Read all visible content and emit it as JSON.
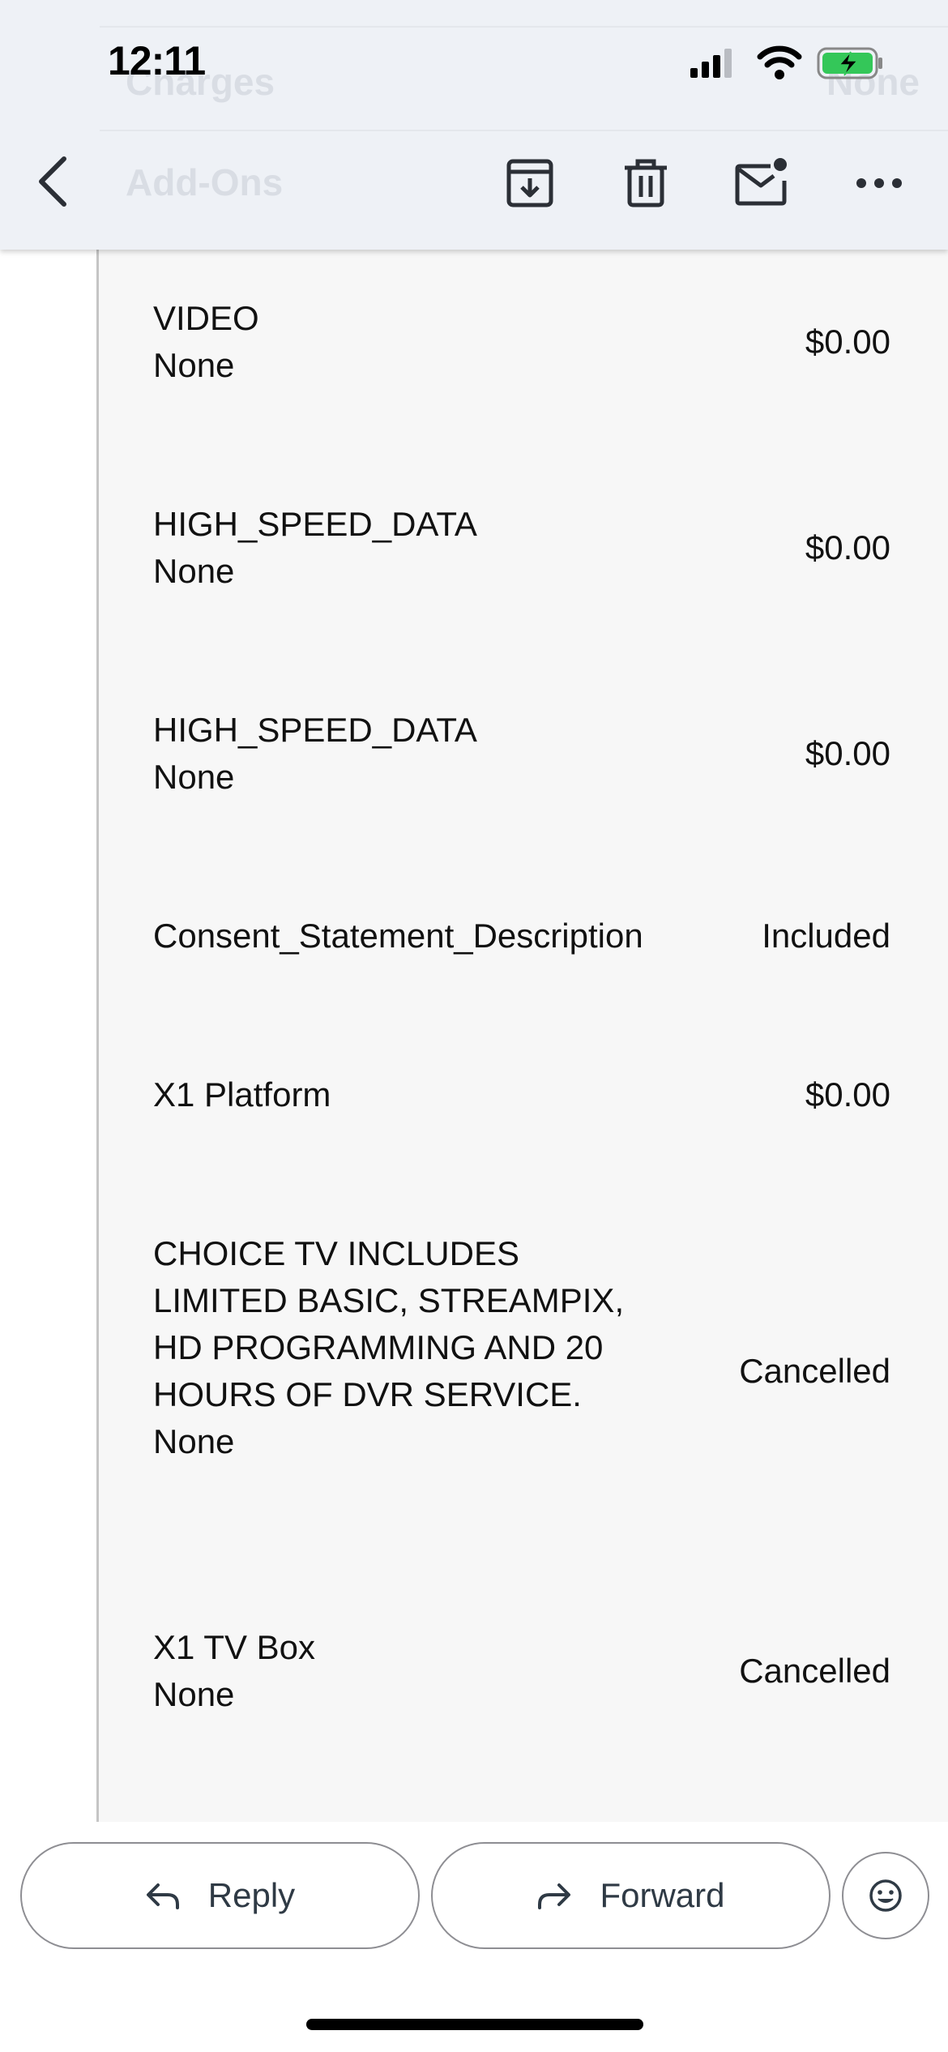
{
  "status_bar": {
    "time": "12:11"
  },
  "ghost_header": {
    "charges_label": "Charges",
    "charges_value": "None",
    "addons_label": "Add-Ons"
  },
  "toolbar": {
    "back": "back-icon",
    "archive": "archive-icon",
    "delete": "trash-icon",
    "mark_unread": "mail-unread-icon",
    "more": "more-icon"
  },
  "items": [
    {
      "label": "VIDEO",
      "sublabel": "None",
      "value": "$0.00"
    },
    {
      "label": "HIGH_SPEED_DATA",
      "sublabel": "None",
      "value": "$0.00"
    },
    {
      "label": "HIGH_SPEED_DATA",
      "sublabel": "None",
      "value": "$0.00"
    },
    {
      "label": "Consent_Statement_Description",
      "sublabel": "",
      "value": "Included"
    },
    {
      "label": "X1 Platform",
      "sublabel": "",
      "value": "$0.00"
    },
    {
      "label": "CHOICE TV INCLUDES LIMITED BASIC, STREAMPIX, HD PROGRAMMING AND 20 HOURS OF DVR SERVICE.",
      "sublabel": "None",
      "value": "Cancelled"
    },
    {
      "label": "X1 TV Box",
      "sublabel": "None",
      "value": "Cancelled"
    }
  ],
  "actions": {
    "reply_label": "Reply",
    "forward_label": "Forward"
  },
  "colors": {
    "header_bg": "#eef1f6",
    "panel_bg": "#f7f7f7",
    "battery_green": "#34c759"
  }
}
